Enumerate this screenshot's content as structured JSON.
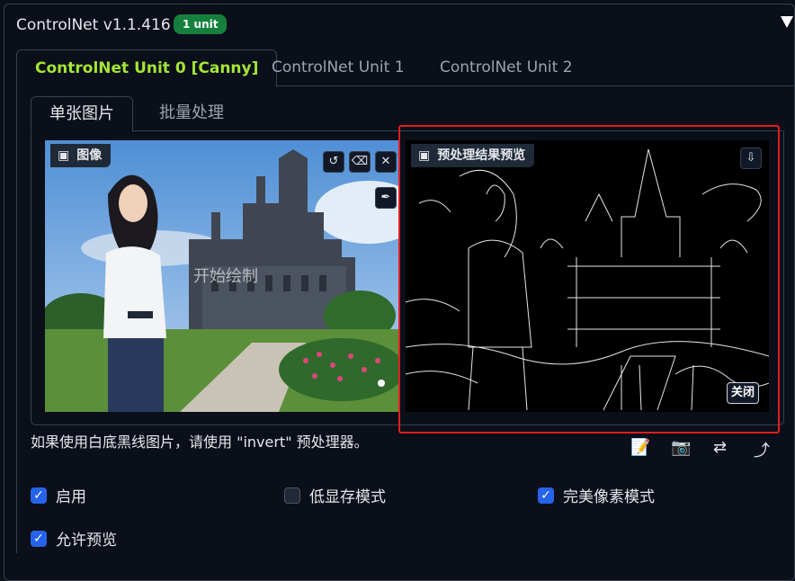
{
  "header": {
    "title": "ControlNet v1.1.416",
    "badge": "1 unit"
  },
  "unit_tabs": [
    {
      "label": "ControlNet Unit 0 [Canny]",
      "active": true
    },
    {
      "label": "ControlNet Unit 1",
      "active": false
    },
    {
      "label": "ControlNet Unit 2",
      "active": false
    }
  ],
  "mode_tabs": [
    {
      "label": "单张图片",
      "active": true
    },
    {
      "label": "批量处理",
      "active": false
    }
  ],
  "image_panel": {
    "label": "图像",
    "watermark": "开始绘制"
  },
  "preview_panel": {
    "label": "预处理结果预览",
    "close_label": "关闭"
  },
  "hint": "如果使用白底黑线图片，请使用 \"invert\" 预处理器。",
  "options": {
    "enable": {
      "label": "启用",
      "checked": true
    },
    "low_vram": {
      "label": "低显存模式",
      "checked": false
    },
    "pixel_perfect": {
      "label": "完美像素模式",
      "checked": true
    },
    "allow_preview": {
      "label": "允许预览",
      "checked": true
    }
  },
  "colors": {
    "accent_green": "#a3e635",
    "badge_green": "#15803d",
    "checkbox_blue": "#2563eb",
    "highlight_red": "#e11d1d"
  }
}
